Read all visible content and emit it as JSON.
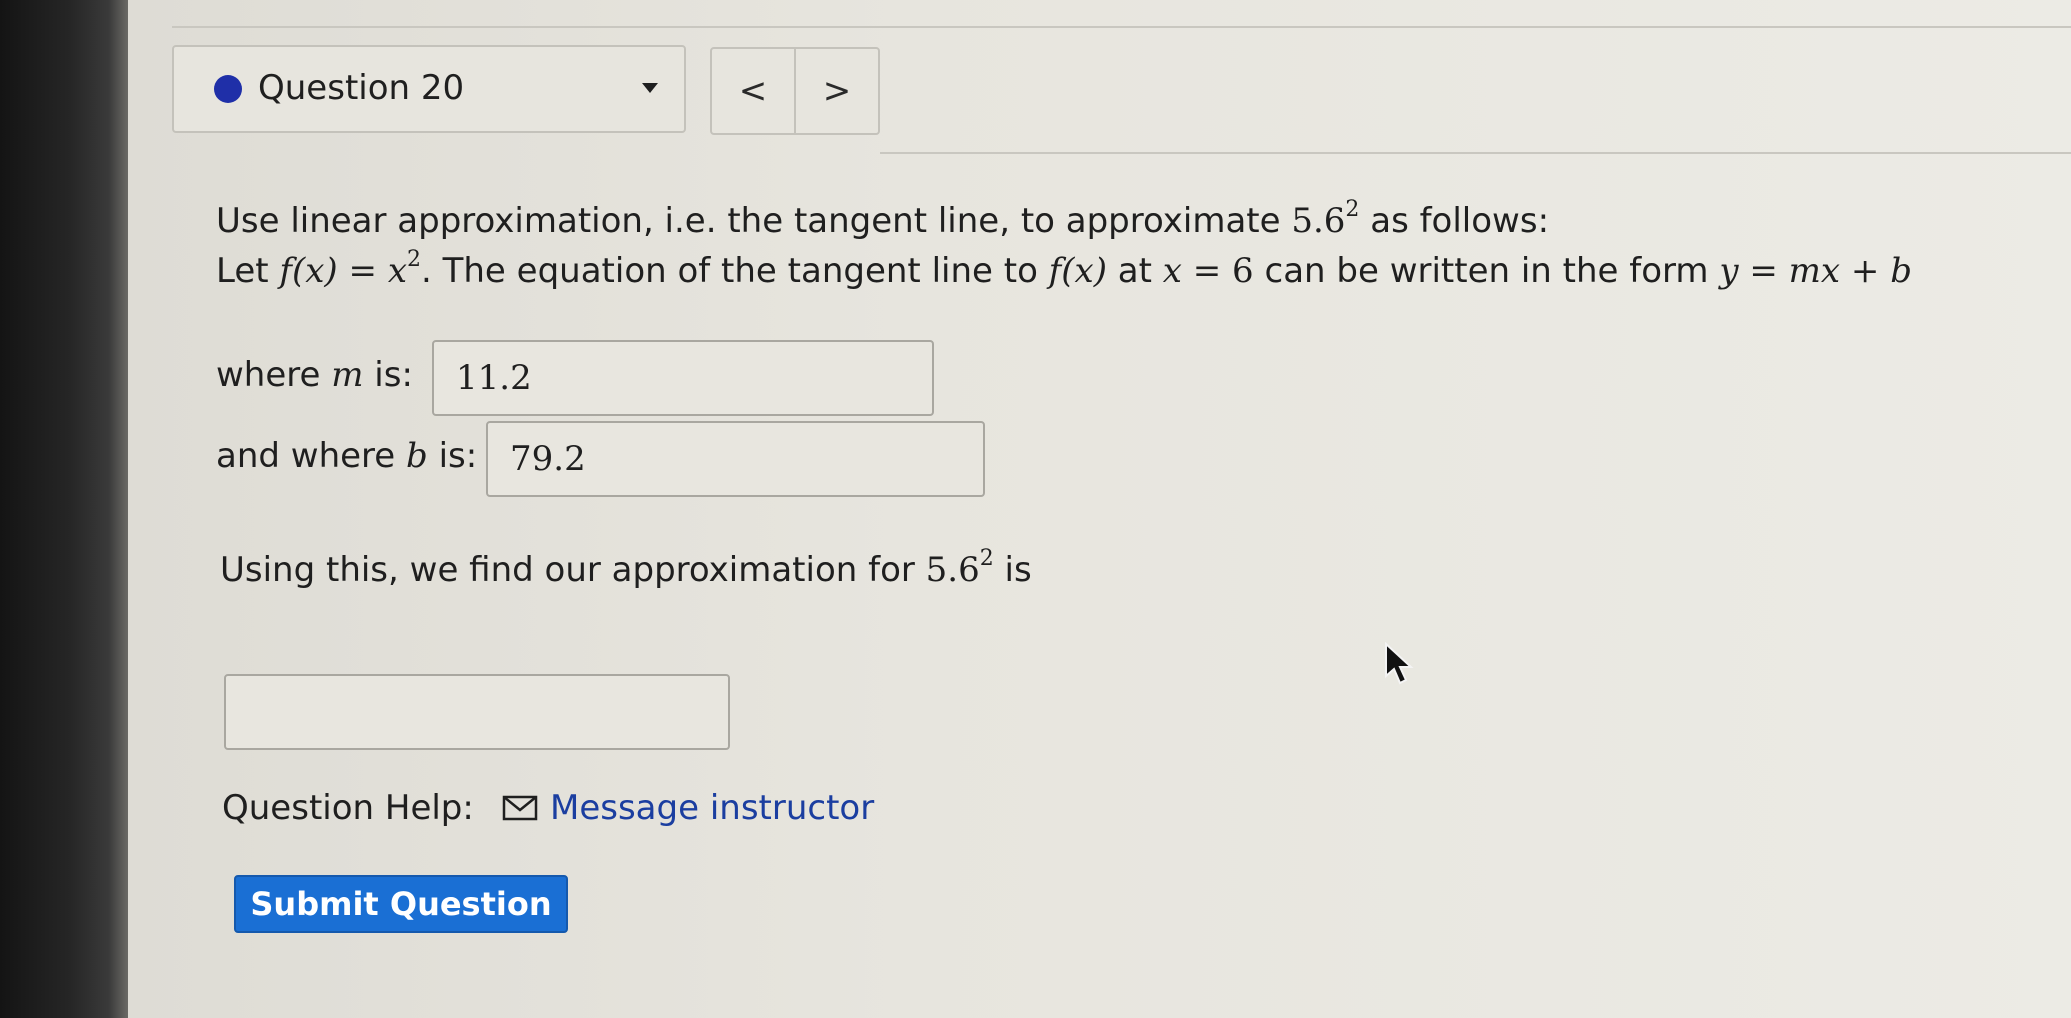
{
  "question_nav": {
    "title": "Question 20",
    "prev_label": "<",
    "next_label": ">",
    "status_color": "#1f2fa8"
  },
  "question": {
    "line1_prefix": "Use linear approximation, i.e. the tangent line, to approximate ",
    "line1_base": "5.6",
    "line1_exp": "2",
    "line1_suffix": " as follows:",
    "line2_let": "Let ",
    "line2_fx": "f(x)",
    "line2_eq": " = ",
    "line2_x": "x",
    "line2_exp": "2",
    "line2_text1": ". The equation of the tangent line to ",
    "line2_fx2": "f(x)",
    "line2_at": " at ",
    "line2_x2": "x",
    "line2_eq6": " = 6",
    "line2_text2": " can be written in the form ",
    "line2_form": "y = mx + b",
    "m_prefix": "where ",
    "m_var": "m",
    "m_suffix": " is:",
    "b_prefix": "and where ",
    "b_var": "b",
    "b_suffix": " is:",
    "using_prefix": "Using this, we find our approximation for ",
    "using_base": "5.6",
    "using_exp": "2",
    "using_suffix": " is"
  },
  "answers": {
    "m_value": "11.2",
    "b_value": "79.2",
    "approx_value": ""
  },
  "help": {
    "label": "Question Help:",
    "message_link": "Message instructor"
  },
  "actions": {
    "submit_label": "Submit Question",
    "submit_color": "#1a6fd4"
  }
}
